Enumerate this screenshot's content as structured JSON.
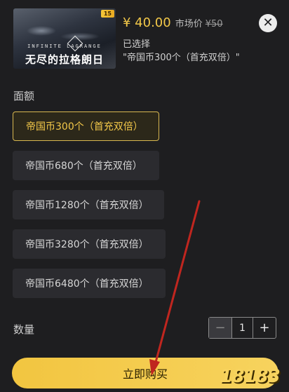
{
  "product": {
    "thumbnail": {
      "badge": "15",
      "subtitle": "INFINITE LAGRANGE",
      "title": "无尽的拉格朗日"
    },
    "price": "¥ 40.00",
    "market_label": "市场价",
    "market_price": "¥50",
    "selected_label": "已选择",
    "selected_value": "\"帝国币300个（首充双倍）\""
  },
  "close_icon": "close-icon",
  "denomination": {
    "label": "面额",
    "options": [
      {
        "label": "帝国币300个（首充双倍）",
        "selected": true
      },
      {
        "label": "帝国币680个（首充双倍）",
        "selected": false
      },
      {
        "label": "帝国币1280个（首充双倍）",
        "selected": false
      },
      {
        "label": "帝国币3280个（首充双倍）",
        "selected": false
      },
      {
        "label": "帝国币6480个（首充双倍）",
        "selected": false
      }
    ]
  },
  "quantity": {
    "label": "数量",
    "minus": "−",
    "value": "1",
    "plus": "+"
  },
  "buy_button": "立即购买",
  "watermark": "18183",
  "colors": {
    "accent": "#f3c849",
    "background": "#1e1e20",
    "option_bg": "#2b2b2f",
    "annotation_arrow": "#c0261f"
  }
}
